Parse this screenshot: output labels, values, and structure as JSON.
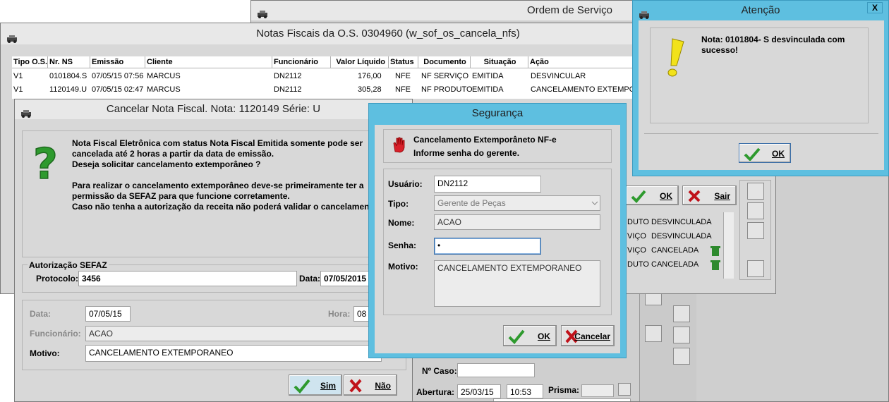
{
  "os_window": {
    "title": "Ordem de Serviço"
  },
  "nfs_window": {
    "title": "Notas Fiscais da O.S. 0304960 (w_sof_os_cancela_nfs)",
    "columns": [
      "Tipo O.S.",
      "Nr. NS",
      "Emissão",
      "Cliente",
      "Funcionário",
      "Valor Líquido",
      "Status",
      "Documento",
      "Situação",
      "Ação"
    ],
    "rows": [
      {
        "tipo": "V1",
        "nr": "0101804.S",
        "emissao": "07/05/15 07:56",
        "cliente": "MARCUS",
        "func": "DN2112",
        "valor": "176,00",
        "status": "NFE",
        "doc": "NF SERVIÇO",
        "situacao": "EMITIDA",
        "acao": "DESVINCULAR"
      },
      {
        "tipo": "V1",
        "nr": "1120149.U",
        "emissao": "07/05/15 02:47",
        "cliente": "MARCUS",
        "func": "DN2112",
        "valor": "305,28",
        "status": "NFE",
        "doc": "NF PRODUTO",
        "situacao": "EMITIDA",
        "acao": "CANCELAMENTO EXTEMPORA"
      }
    ],
    "side_rows": [
      {
        "a": "DUTO",
        "b": "DESVINCULADA"
      },
      {
        "a": "VIÇO",
        "b": "DESVINCULADA"
      },
      {
        "a": "VIÇO",
        "b": "CANCELADA"
      },
      {
        "a": "DUTO",
        "b": "CANCELADA"
      }
    ],
    "ok_label": "OK",
    "sair_label": "Sair"
  },
  "cancel_window": {
    "title": "Cancelar Nota Fiscal. Nota: 1120149 Série: U",
    "message": "Nota Fiscal Eletrônica com status Nota Fiscal Emitida somente pode ser\ncancelada até 2 horas a partir da data de emissão.\nDeseja solicitar cancelamento extemporâneo ?\n\nPara realizar o cancelamento extemporâneo deve-se primeiramente ter a\npermissão da SEFAZ para que funcione corretamente.\nCaso não tenha a autorização da receita não poderá validar o cancelamento",
    "group_label": "Autorização SEFAZ",
    "protocolo_label": "Protocolo:",
    "protocolo_value": "3456",
    "data_label": "Data:",
    "data_value": "07/05/2015",
    "data2_label": "Data:",
    "data2_value": "07/05/15",
    "hora_label": "Hora:",
    "hora_value": "08",
    "funcionario_label": "Funcionário:",
    "funcionario_value": "ACAO",
    "motivo_label": "Motivo:",
    "motivo_value": "CANCELAMENTO EXTEMPORANEO",
    "sim_label": "Sim",
    "nao_label": "Não"
  },
  "seguranca_window": {
    "title": "Segurança",
    "message": "Cancelamento Extemporâneto NF-e\nInforme senha do gerente.",
    "usuario_label": "Usuário:",
    "usuario_value": "DN2112",
    "tipo_label": "Tipo:",
    "tipo_value": "Gerente de Peças",
    "nome_label": "Nome:",
    "nome_value": "ACAO",
    "senha_label": "Senha:",
    "senha_value": "•",
    "motivo_label": "Motivo:",
    "motivo_value": "CANCELAMENTO EXTEMPORANEO",
    "ok_label": "OK",
    "cancelar_label": "Cancelar"
  },
  "atencao_window": {
    "title": "Atenção",
    "close_label": "X",
    "message": "Nota: 0101804- S desvinculada com\nsucesso!",
    "ok_label": "OK"
  },
  "os_bottom": {
    "caso_label": "Nº Caso:",
    "abertura_label": "Abertura:",
    "abertura_date": "25/03/15",
    "abertura_time": "10:53",
    "prisma_label": "Prisma:"
  },
  "colors": {
    "dialog_blue": "#5ebfe0",
    "window_gray": "#d8d8d8",
    "ok_green": "#2e9a2e",
    "cancel_red": "#c0121a"
  }
}
